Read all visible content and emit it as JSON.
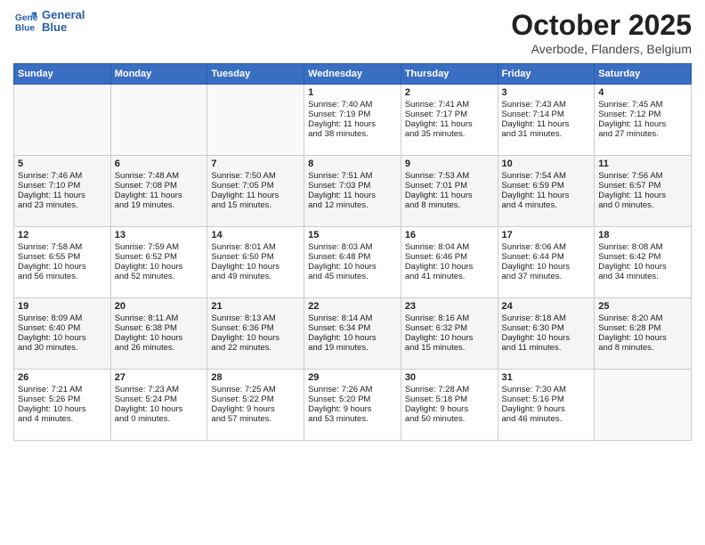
{
  "header": {
    "logo_line1": "General",
    "logo_line2": "Blue",
    "month_title": "October 2025",
    "location": "Averbode, Flanders, Belgium"
  },
  "weekdays": [
    "Sunday",
    "Monday",
    "Tuesday",
    "Wednesday",
    "Thursday",
    "Friday",
    "Saturday"
  ],
  "weeks": [
    [
      {
        "day": "",
        "content": ""
      },
      {
        "day": "",
        "content": ""
      },
      {
        "day": "",
        "content": ""
      },
      {
        "day": "1",
        "content": "Sunrise: 7:40 AM\nSunset: 7:19 PM\nDaylight: 11 hours\nand 38 minutes."
      },
      {
        "day": "2",
        "content": "Sunrise: 7:41 AM\nSunset: 7:17 PM\nDaylight: 11 hours\nand 35 minutes."
      },
      {
        "day": "3",
        "content": "Sunrise: 7:43 AM\nSunset: 7:14 PM\nDaylight: 11 hours\nand 31 minutes."
      },
      {
        "day": "4",
        "content": "Sunrise: 7:45 AM\nSunset: 7:12 PM\nDaylight: 11 hours\nand 27 minutes."
      }
    ],
    [
      {
        "day": "5",
        "content": "Sunrise: 7:46 AM\nSunset: 7:10 PM\nDaylight: 11 hours\nand 23 minutes."
      },
      {
        "day": "6",
        "content": "Sunrise: 7:48 AM\nSunset: 7:08 PM\nDaylight: 11 hours\nand 19 minutes."
      },
      {
        "day": "7",
        "content": "Sunrise: 7:50 AM\nSunset: 7:05 PM\nDaylight: 11 hours\nand 15 minutes."
      },
      {
        "day": "8",
        "content": "Sunrise: 7:51 AM\nSunset: 7:03 PM\nDaylight: 11 hours\nand 12 minutes."
      },
      {
        "day": "9",
        "content": "Sunrise: 7:53 AM\nSunset: 7:01 PM\nDaylight: 11 hours\nand 8 minutes."
      },
      {
        "day": "10",
        "content": "Sunrise: 7:54 AM\nSunset: 6:59 PM\nDaylight: 11 hours\nand 4 minutes."
      },
      {
        "day": "11",
        "content": "Sunrise: 7:56 AM\nSunset: 6:57 PM\nDaylight: 11 hours\nand 0 minutes."
      }
    ],
    [
      {
        "day": "12",
        "content": "Sunrise: 7:58 AM\nSunset: 6:55 PM\nDaylight: 10 hours\nand 56 minutes."
      },
      {
        "day": "13",
        "content": "Sunrise: 7:59 AM\nSunset: 6:52 PM\nDaylight: 10 hours\nand 52 minutes."
      },
      {
        "day": "14",
        "content": "Sunrise: 8:01 AM\nSunset: 6:50 PM\nDaylight: 10 hours\nand 49 minutes."
      },
      {
        "day": "15",
        "content": "Sunrise: 8:03 AM\nSunset: 6:48 PM\nDaylight: 10 hours\nand 45 minutes."
      },
      {
        "day": "16",
        "content": "Sunrise: 8:04 AM\nSunset: 6:46 PM\nDaylight: 10 hours\nand 41 minutes."
      },
      {
        "day": "17",
        "content": "Sunrise: 8:06 AM\nSunset: 6:44 PM\nDaylight: 10 hours\nand 37 minutes."
      },
      {
        "day": "18",
        "content": "Sunrise: 8:08 AM\nSunset: 6:42 PM\nDaylight: 10 hours\nand 34 minutes."
      }
    ],
    [
      {
        "day": "19",
        "content": "Sunrise: 8:09 AM\nSunset: 6:40 PM\nDaylight: 10 hours\nand 30 minutes."
      },
      {
        "day": "20",
        "content": "Sunrise: 8:11 AM\nSunset: 6:38 PM\nDaylight: 10 hours\nand 26 minutes."
      },
      {
        "day": "21",
        "content": "Sunrise: 8:13 AM\nSunset: 6:36 PM\nDaylight: 10 hours\nand 22 minutes."
      },
      {
        "day": "22",
        "content": "Sunrise: 8:14 AM\nSunset: 6:34 PM\nDaylight: 10 hours\nand 19 minutes."
      },
      {
        "day": "23",
        "content": "Sunrise: 8:16 AM\nSunset: 6:32 PM\nDaylight: 10 hours\nand 15 minutes."
      },
      {
        "day": "24",
        "content": "Sunrise: 8:18 AM\nSunset: 6:30 PM\nDaylight: 10 hours\nand 11 minutes."
      },
      {
        "day": "25",
        "content": "Sunrise: 8:20 AM\nSunset: 6:28 PM\nDaylight: 10 hours\nand 8 minutes."
      }
    ],
    [
      {
        "day": "26",
        "content": "Sunrise: 7:21 AM\nSunset: 5:26 PM\nDaylight: 10 hours\nand 4 minutes."
      },
      {
        "day": "27",
        "content": "Sunrise: 7:23 AM\nSunset: 5:24 PM\nDaylight: 10 hours\nand 0 minutes."
      },
      {
        "day": "28",
        "content": "Sunrise: 7:25 AM\nSunset: 5:22 PM\nDaylight: 9 hours\nand 57 minutes."
      },
      {
        "day": "29",
        "content": "Sunrise: 7:26 AM\nSunset: 5:20 PM\nDaylight: 9 hours\nand 53 minutes."
      },
      {
        "day": "30",
        "content": "Sunrise: 7:28 AM\nSunset: 5:18 PM\nDaylight: 9 hours\nand 50 minutes."
      },
      {
        "day": "31",
        "content": "Sunrise: 7:30 AM\nSunset: 5:16 PM\nDaylight: 9 hours\nand 46 minutes."
      },
      {
        "day": "",
        "content": ""
      }
    ]
  ]
}
